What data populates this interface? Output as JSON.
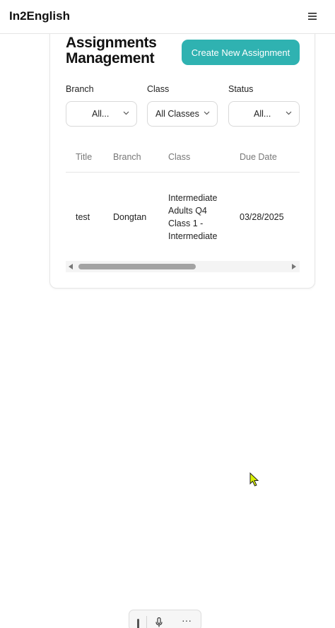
{
  "header": {
    "app_name": "In2English",
    "menu_icon": "hamburger-menu-icon"
  },
  "page": {
    "title": "Assignments Management",
    "create_button": "Create New Assignment",
    "accent_color": "#2fb2b1"
  },
  "filters": {
    "branch": {
      "label": "Branch",
      "value": "All..."
    },
    "class": {
      "label": "Class",
      "value": "All Classes"
    },
    "status": {
      "label": "Status",
      "value": "All..."
    }
  },
  "table": {
    "columns": [
      "Title",
      "Branch",
      "Class",
      "Due Date"
    ],
    "rows": [
      {
        "title": "test",
        "branch": "Dongtan",
        "class_lines": [
          "Intermediate",
          "Adults Q4",
          "Class 1 -",
          "Intermediate"
        ],
        "due_date": "03/28/2025"
      }
    ]
  },
  "scrollbar": {
    "thumb_fraction": 0.5
  },
  "toolbar": {
    "icons": [
      "grip-icon",
      "microphone-icon",
      "more-options-icon"
    ],
    "more_label": "···"
  }
}
